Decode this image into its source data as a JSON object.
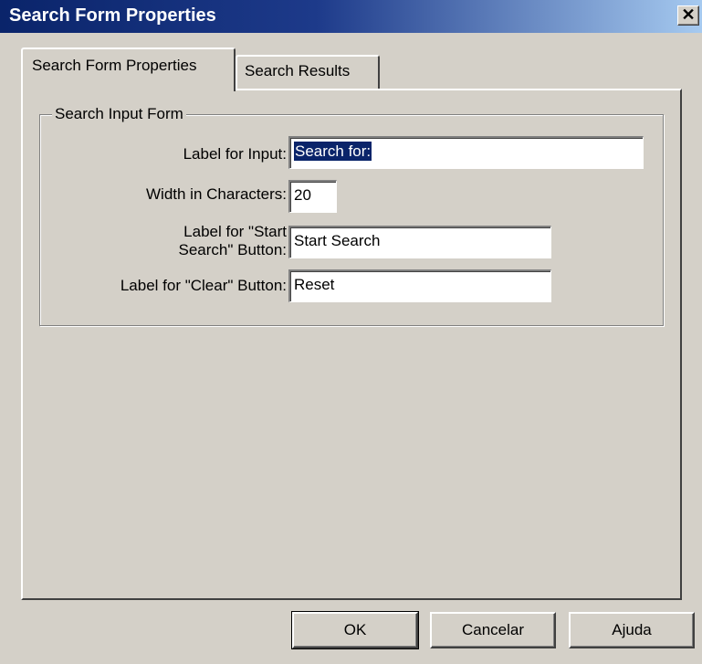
{
  "window": {
    "title": "Search Form Properties",
    "close_glyph": "✕"
  },
  "tabs": [
    {
      "label": "Search Form Properties",
      "active": true
    },
    {
      "label": "Search Results",
      "active": false
    }
  ],
  "group": {
    "legend": "Search Input Form",
    "fields": {
      "label_for_input": {
        "label": "Label for Input:",
        "value": "Search for:"
      },
      "width": {
        "label": "Width in Characters:",
        "value": "20"
      },
      "start_search": {
        "label_line1": "Label for \"Start",
        "label_line2": "Search\" Button:",
        "value": "Start Search"
      },
      "clear": {
        "label": "Label for \"Clear\" Button:",
        "value": "Reset"
      }
    }
  },
  "buttons": {
    "ok": "OK",
    "cancel": "Cancelar",
    "help": "Ajuda"
  },
  "colors": {
    "face": "#d4d0c8",
    "title_active": "#0a246a",
    "selection": "#0a246a"
  }
}
